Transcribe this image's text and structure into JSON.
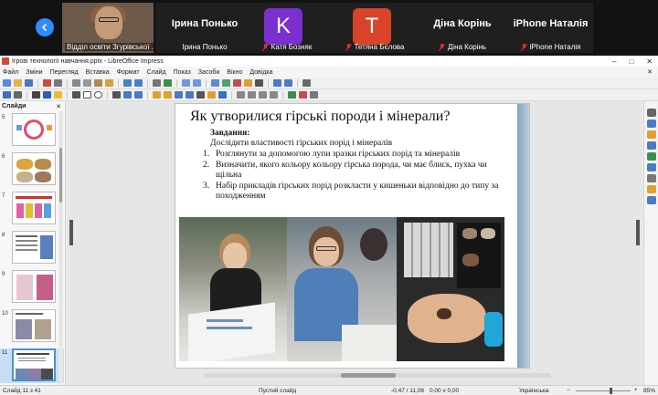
{
  "gallery": {
    "participants": [
      {
        "kind": "video",
        "caption": "Відділ освіти Згурівської ..."
      },
      {
        "kind": "name",
        "display": "Ірина Понько",
        "caption": "Ірина Понько",
        "muted": false
      },
      {
        "kind": "avatar",
        "initial": "K",
        "color": "#7b2fd1",
        "caption": "Катя Бозняк",
        "muted": true
      },
      {
        "kind": "avatar",
        "initial": "T",
        "color": "#d9432a",
        "caption": "Тетяна Бєлова",
        "muted": true
      },
      {
        "kind": "name",
        "display": "Діна Корінь",
        "caption": "Діна Корінь",
        "muted": true
      },
      {
        "kind": "name",
        "display": "iPhone Наталія",
        "caption": "iPhone Наталія",
        "muted": true
      }
    ]
  },
  "window": {
    "title": "Ігрові технології навчання.pptx - LibreOffice Impress",
    "controls": [
      "–",
      "□",
      "✕"
    ]
  },
  "menu": [
    "Файл",
    "Зміни",
    "Перегляд",
    "Вставка",
    "Формат",
    "Слайд",
    "Показ",
    "Засоби",
    "Вікно",
    "Довідка"
  ],
  "close_doc": "✕",
  "slides_panel": {
    "header": "Слайди",
    "close": "✕",
    "thumbs": [
      {
        "num": "5",
        "color": "#e04c6c"
      },
      {
        "num": "6",
        "color": "#d9a53c"
      },
      {
        "num": "7",
        "color": "#e35fa3"
      },
      {
        "num": "8",
        "color": "#5a7fbf"
      },
      {
        "num": "9",
        "color": "#c45f8a"
      },
      {
        "num": "10",
        "color": "#8a8aa8"
      },
      {
        "num": "11",
        "color": "#6a8ab0",
        "selected": true
      }
    ]
  },
  "slide": {
    "title": "Як утворилися гірські породи і мінерали?",
    "task_label": "Завдання:",
    "task_intro": "Дослідити властивості гірських порід і мінералів",
    "tasks": [
      {
        "n": "1.",
        "text": "Розглянути за допомогою лупи зразки гірських порід та мінералів"
      },
      {
        "n": "2.",
        "text": "Визначити, якого кольору кольору гірська порода, чи має блиск, пухка чи щільна"
      },
      {
        "n": "3.",
        "text": "Набір прикладів гірських порід розкласти у кишеньки відповідно до типу за походженням"
      }
    ]
  },
  "statusbar": {
    "slide_pos": "Слайд 11 з 41",
    "layout": "Пустий слайд",
    "coords": "-0,47 / 11,08",
    "size": "0,00 x 0,00",
    "language": "Українська",
    "zoom": "85%"
  },
  "colors": {
    "zoom_blue": "#2d8cff",
    "mute_red": "#e02f2f",
    "selection": "#4a90d9"
  }
}
